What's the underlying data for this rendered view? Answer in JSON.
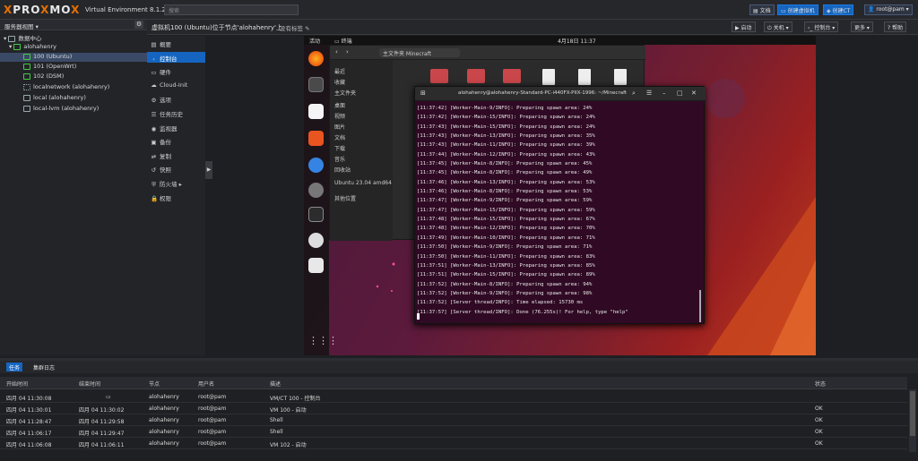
{
  "header": {
    "logo_pro": "PRO",
    "logo_x": "X",
    "logo_mo": "MO",
    "logo_x2": "X",
    "version": "Virtual Environment 8.1.2",
    "search_placeholder": "搜索",
    "btn_docs": "文档",
    "btn_create_vm": "创建虚拟机",
    "btn_create_ct": "创建CT",
    "user": "root@pam"
  },
  "tree": {
    "view_label": "服务器视图",
    "items": [
      {
        "label": "数据中心"
      },
      {
        "label": "alohahenry"
      },
      {
        "label": "100 (Ubuntu)"
      },
      {
        "label": "101 (OpenWrt)"
      },
      {
        "label": "102 (DSM)"
      },
      {
        "label": "localnetwork (alohahenry)"
      },
      {
        "label": "local (alohahenry)"
      },
      {
        "label": "local-lvm (alohahenry)"
      }
    ]
  },
  "content": {
    "title": "虚拟机100 (Ubuntu)位于节点'alohahenry'上",
    "tag": "没有标签",
    "btn_start": "启动",
    "btn_shutdown": "关机",
    "btn_console": "控制台",
    "btn_more": "更多",
    "btn_help": "帮助"
  },
  "vmnav": [
    {
      "icon": "▤",
      "label": "概要"
    },
    {
      "icon": "›",
      "label": "控制台"
    },
    {
      "icon": "▭",
      "label": "硬件"
    },
    {
      "icon": "☁",
      "label": "Cloud-Init"
    },
    {
      "icon": "⚙",
      "label": "选项"
    },
    {
      "icon": "☰",
      "label": "任务历史"
    },
    {
      "icon": "◉",
      "label": "监视器"
    },
    {
      "icon": "▣",
      "label": "备份"
    },
    {
      "icon": "⇄",
      "label": "复制"
    },
    {
      "icon": "↺",
      "label": "快照"
    },
    {
      "icon": "⛨",
      "label": "防火墙"
    },
    {
      "icon": "🔒",
      "label": "权限"
    }
  ],
  "desktop": {
    "activities": "活动",
    "terminal_menu": "终端",
    "clock": "4月18日 11:37",
    "files": {
      "path": "主文件夹   Minecraft",
      "sidebar": [
        "最近",
        "收藏",
        "主文件夹",
        "桌面",
        "视频",
        "图片",
        "文档",
        "下载",
        "音乐",
        "回收站",
        "Ubuntu 23.04 amd64",
        "其他位置"
      ]
    },
    "terminal": {
      "title": "alohahenry@alohahenry-Standard-PC-i440FX-PIIX-1996: ~/Minecraft",
      "lines": [
        "[11:37:42] [Worker-Main-9/INFO]: Preparing spawn area: 24%",
        "[11:37:42] [Worker-Main-15/INFO]: Preparing spawn area: 24%",
        "[11:37:43] [Worker-Main-15/INFO]: Preparing spawn area: 24%",
        "[11:37:43] [Worker-Main-13/INFO]: Preparing spawn area: 35%",
        "[11:37:43] [Worker-Main-11/INFO]: Preparing spawn area: 39%",
        "[11:37:44] [Worker-Main-12/INFO]: Preparing spawn area: 43%",
        "[11:37:45] [Worker-Main-8/INFO]: Preparing spawn area: 45%",
        "[11:37:45] [Worker-Main-8/INFO]: Preparing spawn area: 49%",
        "[11:37:46] [Worker-Main-13/INFO]: Preparing spawn area: 53%",
        "[11:37:46] [Worker-Main-8/INFO]: Preparing spawn area: 53%",
        "[11:37:47] [Worker-Main-9/INFO]: Preparing spawn area: 59%",
        "[11:37:47] [Worker-Main-15/INFO]: Preparing spawn area: 59%",
        "[11:37:48] [Worker-Main-15/INFO]: Preparing spawn area: 67%",
        "[11:37:48] [Worker-Main-12/INFO]: Preparing spawn area: 70%",
        "[11:37:49] [Worker-Main-10/INFO]: Preparing spawn area: 71%",
        "[11:37:50] [Worker-Main-9/INFO]: Preparing spawn area: 71%",
        "[11:37:50] [Worker-Main-11/INFO]: Preparing spawn area: 83%",
        "[11:37:51] [Worker-Main-13/INFO]: Preparing spawn area: 85%",
        "[11:37:51] [Worker-Main-15/INFO]: Preparing spawn area: 89%",
        "[11:37:52] [Worker-Main-8/INFO]: Preparing spawn area: 94%",
        "[11:37:52] [Worker-Main-9/INFO]: Preparing spawn area: 98%",
        "[11:37:52] [Server thread/INFO]: Time elapsed: 15730 ms",
        "[11:37:57] [Server thread/INFO]: Done (76.255s)! For help, type \"help\""
      ]
    }
  },
  "log": {
    "tab_tasks": "任务",
    "tab_cluster": "集群日志",
    "headers": [
      "开始时间",
      "结束时间",
      "节点",
      "用户名",
      "描述",
      "状态"
    ],
    "rows": [
      [
        "四月 04 11:30:08",
        "",
        "alohahenry",
        "root@pam",
        "VM/CT 100 - 控制台",
        ""
      ],
      [
        "四月 04 11:30:01",
        "四月 04 11:30:02",
        "alohahenry",
        "root@pam",
        "VM 100 - 启动",
        "OK"
      ],
      [
        "四月 04 11:28:47",
        "四月 04 11:29:58",
        "alohahenry",
        "root@pam",
        "Shell",
        "OK"
      ],
      [
        "四月 04 11:06:17",
        "四月 04 11:29:47",
        "alohahenry",
        "root@pam",
        "Shell",
        "OK"
      ],
      [
        "四月 04 11:06:08",
        "四月 04 11:06:11",
        "alohahenry",
        "root@pam",
        "VM 102 - 启动",
        "OK"
      ]
    ]
  }
}
